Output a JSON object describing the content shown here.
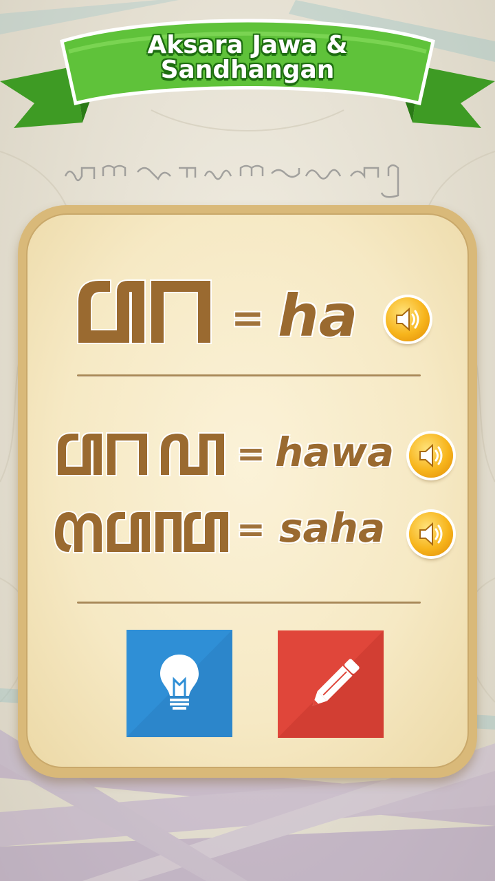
{
  "header": {
    "title_line1": "Aksara Jawa &",
    "title_line2": "Sandhangan"
  },
  "lesson": {
    "main": {
      "equals": "=",
      "latin": "ha",
      "sound_icon": "speaker-icon"
    },
    "examples": [
      {
        "equals": "=",
        "latin": "hawa",
        "sound_icon": "speaker-icon"
      },
      {
        "equals": "=",
        "latin": "saha",
        "sound_icon": "speaker-icon"
      }
    ]
  },
  "actions": {
    "hint": {
      "icon": "lightbulb-icon",
      "color": "#2f8fd6"
    },
    "write": {
      "icon": "pencil-icon",
      "color": "#e0463a"
    }
  },
  "colors": {
    "banner_green": "#5fc23a",
    "card": "#f6e9c4",
    "glyph_brown": "#9a6a30",
    "sound_button": "#f7b51c"
  }
}
